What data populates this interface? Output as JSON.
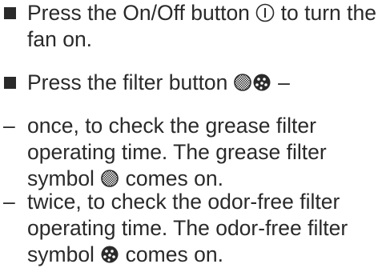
{
  "instructions": [
    {
      "marker": "square",
      "lines": [
        {
          "before": "Press the On/Off button ",
          "icon": "power-icon",
          "after": " to turn the"
        },
        {
          "before": "fan on."
        }
      ]
    },
    {
      "marker": "square",
      "lines": [
        {
          "before": "Press the filter button ",
          "icon": "filter-buttons-icon",
          "after": " –"
        }
      ]
    },
    {
      "marker": "–",
      "lines": [
        {
          "before": "once, to check the grease filter"
        },
        {
          "before": "operating time. The grease filter"
        },
        {
          "before": "symbol ",
          "icon": "grease-filter-icon",
          "after": " comes on."
        }
      ]
    },
    {
      "marker": "–",
      "lines": [
        {
          "before": "twice, to check the odor-free filter"
        },
        {
          "before": "operating time. The odor-free filter"
        },
        {
          "before": "symbol ",
          "icon": "odor-filter-icon",
          "after": " comes on."
        }
      ]
    }
  ]
}
